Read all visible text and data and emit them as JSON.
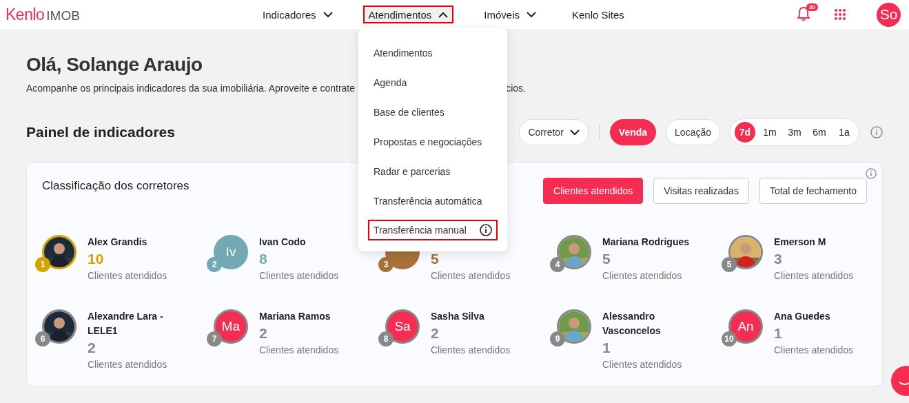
{
  "header": {
    "logo_brand": "Kenlo",
    "logo_product": "IMOB",
    "nav": [
      {
        "label": "Indicadores",
        "kind": "menu",
        "expanded": false,
        "highlighted": false
      },
      {
        "label": "Atendimentos",
        "kind": "menu",
        "expanded": true,
        "highlighted": true
      },
      {
        "label": "Imóveis",
        "kind": "menu",
        "expanded": false,
        "highlighted": false
      },
      {
        "label": "Kenlo Sites",
        "kind": "link",
        "highlighted": false
      }
    ],
    "notifications": {
      "count": "30"
    },
    "user": {
      "initials": "So"
    }
  },
  "nav_menu": {
    "items": [
      {
        "label": "Atendimentos",
        "highlighted": false,
        "info": false
      },
      {
        "label": "Agenda",
        "highlighted": false,
        "info": false
      },
      {
        "label": "Base de clientes",
        "highlighted": false,
        "info": false
      },
      {
        "label": "Propostas e negociações",
        "highlighted": false,
        "info": false
      },
      {
        "label": "Radar e parcerias",
        "highlighted": false,
        "info": false
      },
      {
        "label": "Transferência automática",
        "highlighted": false,
        "info": false
      },
      {
        "label": "Transferência manual",
        "highlighted": true,
        "info": true
      }
    ]
  },
  "greeting": {
    "title": "Olá, Solange Araujo",
    "subtitle_start": "Acompanhe os principais indicadores da sua imobiliária. Aproveite e contrate",
    "subtitle_end": "cios."
  },
  "dashboard": {
    "title": "Painel de indicadores",
    "filters": [
      {
        "label": "Corretor"
      }
    ],
    "business_types": [
      {
        "label": "Venda",
        "selected": true
      },
      {
        "label": "Locação",
        "selected": false
      }
    ],
    "periods": [
      {
        "label": "7d",
        "selected": true
      },
      {
        "label": "1m",
        "selected": false
      },
      {
        "label": "3m",
        "selected": false
      },
      {
        "label": "6m",
        "selected": false
      },
      {
        "label": "1a",
        "selected": false
      }
    ]
  },
  "ranking": {
    "title": "Classificação dos corretores",
    "metrics": [
      {
        "label": "Clientes atendidos",
        "selected": true
      },
      {
        "label": "Visitas realizadas",
        "selected": false
      },
      {
        "label": "Total de fechamento",
        "selected": false
      }
    ],
    "brokers": [
      {
        "rank": "1",
        "name": "Alex Grandis",
        "value": "10",
        "caption": "Clientes atendidos",
        "color": "#d4a300"
      },
      {
        "rank": "2",
        "name": "Ivan Codo",
        "value": "8",
        "caption": "Clientes atendidos",
        "color": "#72a9b4",
        "avatar": {
          "kind": "initials",
          "initials": "Iv",
          "color": "#72a9b4"
        }
      },
      {
        "rank": "3",
        "value": "5",
        "caption": "Clientes atendidos",
        "color": "#a8713a",
        "avatar": {
          "kind": "initials",
          "color": "#a8713a"
        }
      },
      {
        "rank": "4",
        "name": "Mariana Rodrigues",
        "value": "5",
        "caption": "Clientes atendidos",
        "color": "#888888"
      },
      {
        "rank": "5",
        "name": "Emerson M",
        "value": "3",
        "caption": "Clientes atendidos",
        "color": "#888888"
      },
      {
        "rank": "6",
        "name": "Alexandre Lara - LELE1",
        "value": "2",
        "caption": "Clientes atendidos",
        "color": "#888888"
      },
      {
        "rank": "7",
        "name": "Mariana Ramos",
        "value": "2",
        "caption": "Clientes atendidos",
        "color": "#888888",
        "avatar": {
          "kind": "initials",
          "initials": "Ma",
          "color": "#f52d52"
        }
      },
      {
        "rank": "8",
        "name": "Sasha Silva",
        "value": "2",
        "caption": "Clientes atendidos",
        "color": "#888888",
        "avatar": {
          "kind": "initials",
          "initials": "Sa",
          "color": "#f52d52"
        }
      },
      {
        "rank": "9",
        "name": "Alessandro Vasconcelos",
        "value": "1",
        "caption": "Clientes atendidos",
        "color": "#888888"
      },
      {
        "rank": "10",
        "name": "Ana Guedes",
        "value": "1",
        "caption": "Clientes atendidos",
        "color": "#888888",
        "avatar": {
          "kind": "initials",
          "initials": "An",
          "color": "#f52d52"
        }
      }
    ]
  }
}
